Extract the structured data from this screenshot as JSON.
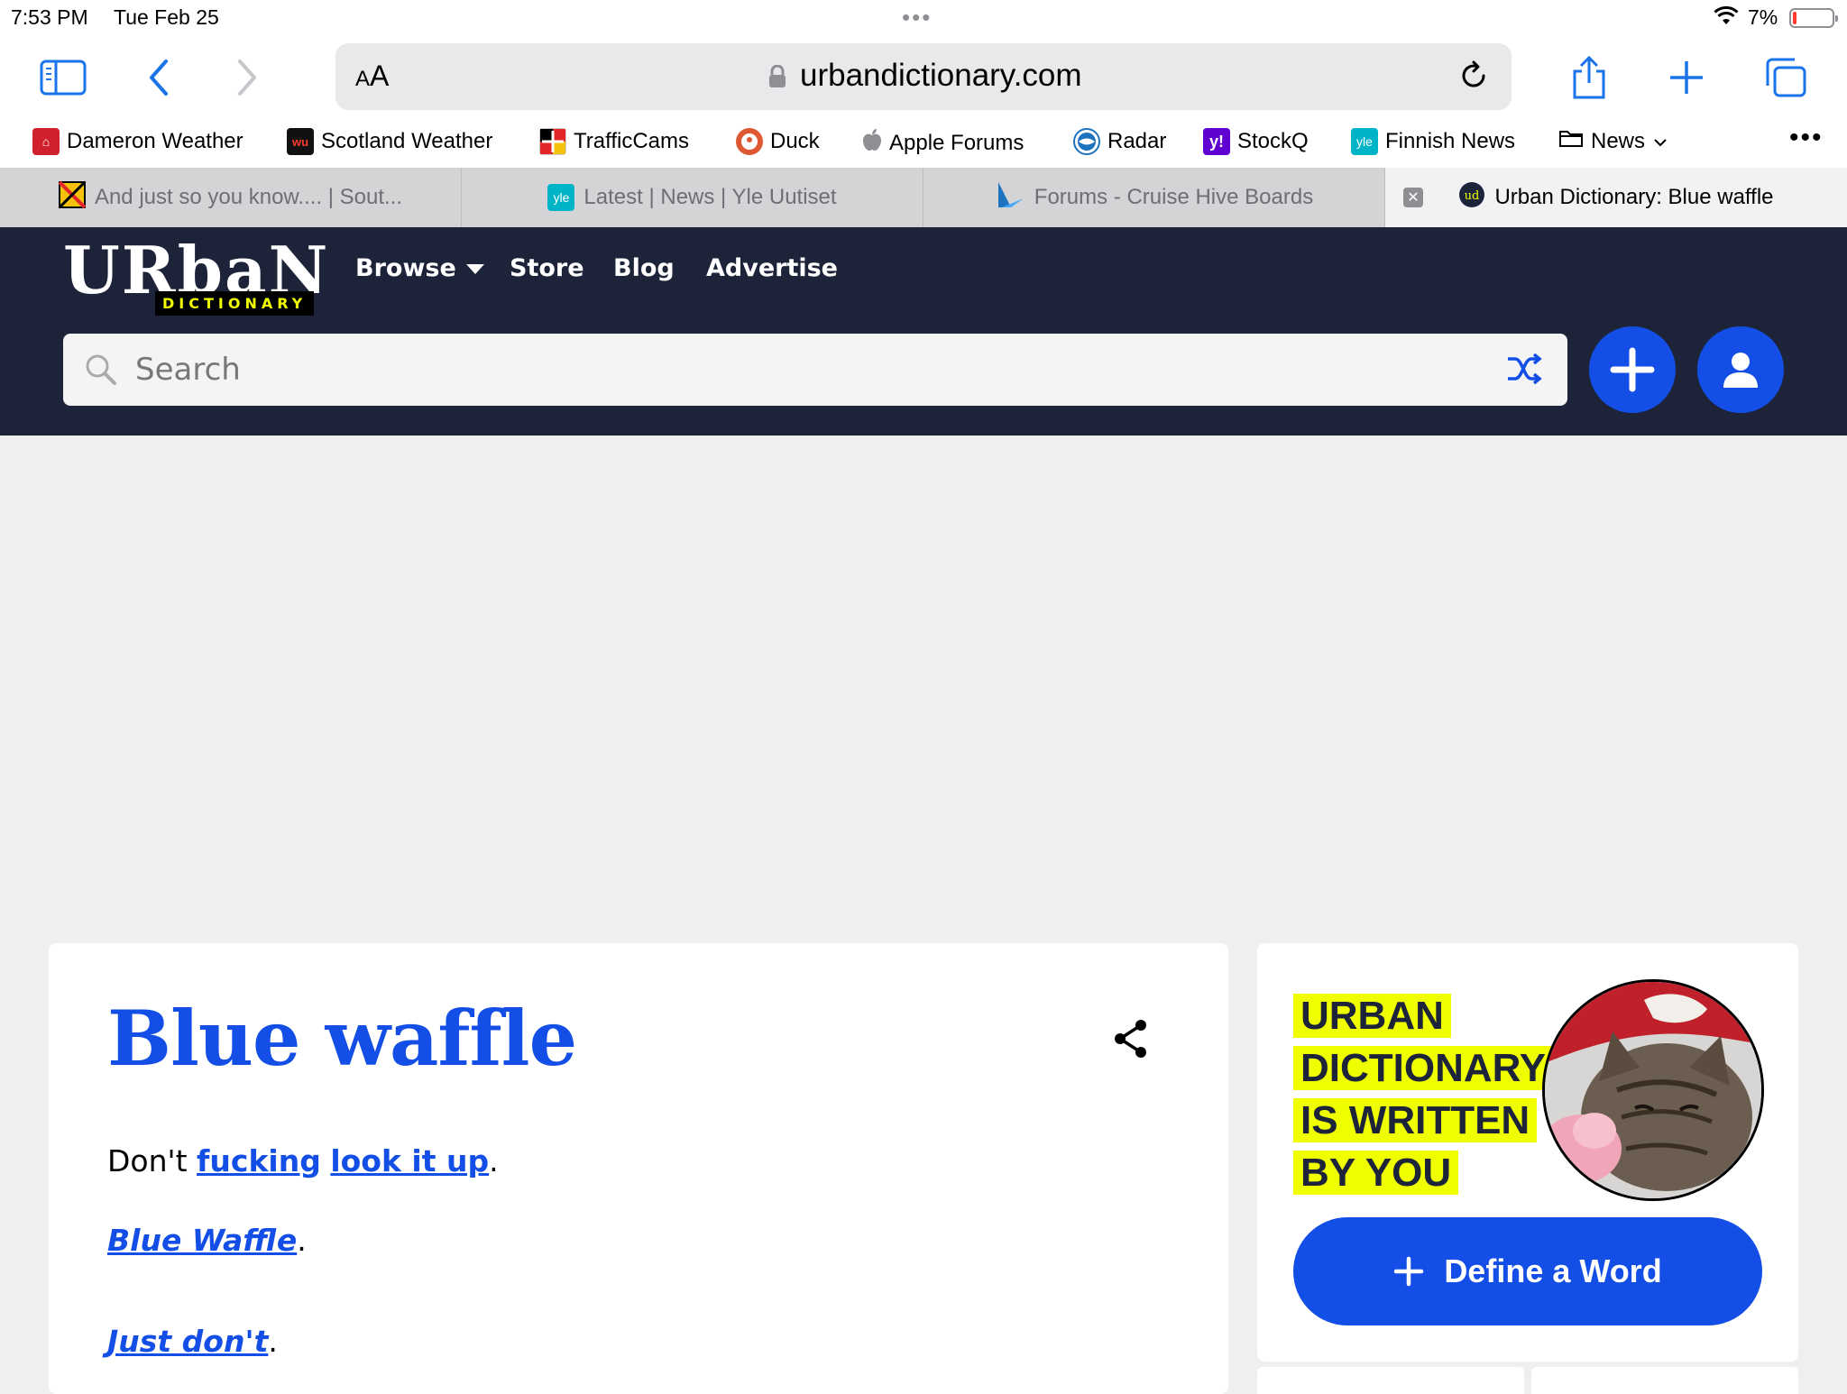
{
  "status": {
    "time": "7:53 PM",
    "date": "Tue Feb 25",
    "battery": "7%"
  },
  "browser": {
    "url": "urbandictionary.com",
    "aa": "AA",
    "bookmarks": [
      {
        "label": "Dameron Weather",
        "icon": "house-icon",
        "color": "#d0202e"
      },
      {
        "label": "Scotland Weather",
        "icon": "wu-icon",
        "color": "#111111"
      },
      {
        "label": "TrafficCams",
        "icon": "flag-icon",
        "color": "#e2262a"
      },
      {
        "label": "Duck",
        "icon": "duck-icon",
        "color": "#de5833"
      },
      {
        "label": "Apple Forums",
        "icon": "apple-icon",
        "color": "#888888"
      },
      {
        "label": "Radar",
        "icon": "noaa-icon",
        "color": "#1e73be"
      },
      {
        "label": "StockQ",
        "icon": "yahoo-icon",
        "color": "#5f01d1"
      },
      {
        "label": "Finnish News",
        "icon": "yle-icon",
        "color": "#00b4c8"
      },
      {
        "label": "News",
        "icon": "folder-icon",
        "color": "#000000"
      }
    ],
    "tabs": [
      {
        "label": "And just so you know.... | Sout...",
        "active": false
      },
      {
        "label": "Latest | News | Yle Uutiset",
        "active": false
      },
      {
        "label": "Forums - Cruise Hive Boards",
        "active": false
      },
      {
        "label": "Urban Dictionary: Blue waffle",
        "active": true
      }
    ]
  },
  "site": {
    "logo": {
      "word": "URbaN",
      "sub": "DICTIONARY"
    },
    "nav": {
      "browse": "Browse",
      "store": "Store",
      "blog": "Blog",
      "advertise": "Advertise"
    },
    "search": {
      "placeholder": "Search"
    }
  },
  "definition": {
    "word": "Blue waffle",
    "line1": {
      "pre": "Don't ",
      "link1": "fucking",
      "link2": "look it up",
      "post": "."
    },
    "line2": {
      "link": "Blue Waffle",
      "post": "."
    },
    "line3": {
      "link": "Just don't",
      "post": "."
    }
  },
  "sidebar": {
    "tagline": "URBAN DICTIONARY IS WRITTEN BY YOU",
    "define_button": "Define a Word"
  },
  "colors": {
    "accent": "#134fe6",
    "header": "#1d2439",
    "highlight": "#efff00"
  }
}
